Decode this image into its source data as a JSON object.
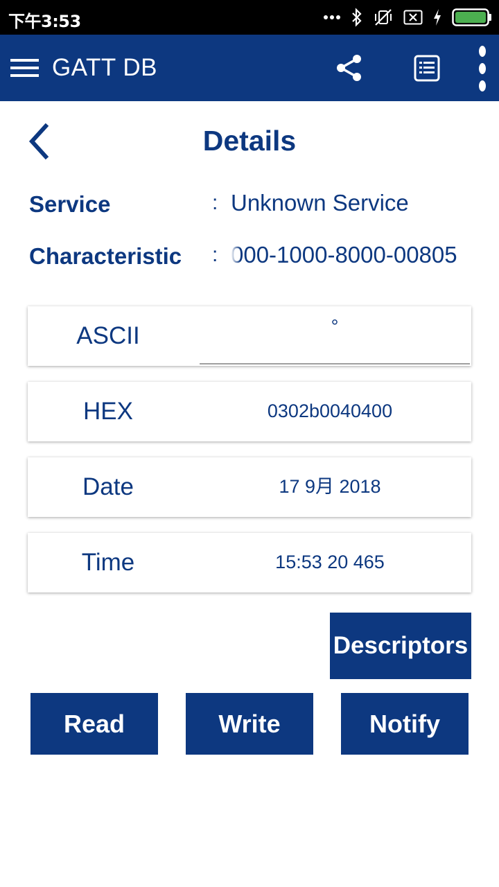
{
  "status_bar": {
    "time": "下午3:53",
    "icons": [
      "dots-icon",
      "bluetooth-icon",
      "vibrate-off-icon",
      "sim-x-icon",
      "charging-icon",
      "battery-icon"
    ],
    "battery_color": "#4caf50"
  },
  "app_bar": {
    "title": "GATT DB",
    "background": "#0d3880",
    "icons": [
      "menu-icon",
      "share-icon",
      "list-icon",
      "more-vert-icon"
    ]
  },
  "details": {
    "title": "Details",
    "service_label": "Service",
    "service_colon": ":",
    "service_value": "Unknown Service",
    "characteristic_label": "Characteristic",
    "characteristic_colon": ":",
    "characteristic_value": "000-1000-8000-00805"
  },
  "cards": {
    "ascii_label": "ASCII",
    "ascii_value": "°",
    "hex_label": "HEX",
    "hex_value": "0302b0040400",
    "date_label": "Date",
    "date_value": "17 9月 2018",
    "time_label": "Time",
    "time_value": "15:53 20 465"
  },
  "buttons": {
    "descriptors": "Descriptors",
    "read": "Read",
    "write": "Write",
    "notify": "Notify"
  }
}
